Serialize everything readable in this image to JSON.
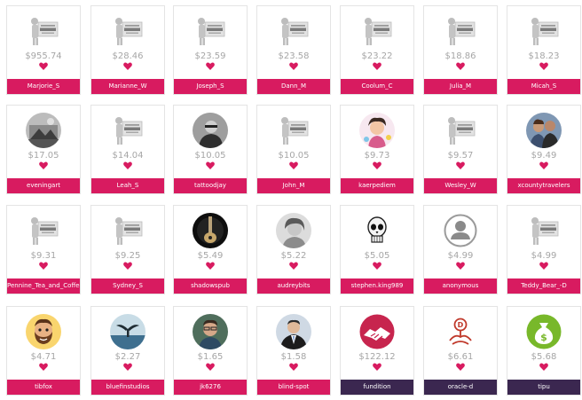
{
  "colors": {
    "name_band": "#d81b60",
    "name_band_org": "#3b2750",
    "heart": "#d81b60",
    "amount_text": "#a6a6a6"
  },
  "cards": [
    {
      "amount": "$955.74",
      "name": "Marjorie_S",
      "avatar": "no-image-placeholder"
    },
    {
      "amount": "$28.46",
      "name": "Marianne_W",
      "avatar": "no-image-placeholder"
    },
    {
      "amount": "$23.59",
      "name": "Joseph_S",
      "avatar": "no-image-placeholder"
    },
    {
      "amount": "$23.58",
      "name": "Dann_M",
      "avatar": "no-image-placeholder"
    },
    {
      "amount": "$23.22",
      "name": "Coolum_C",
      "avatar": "no-image-placeholder"
    },
    {
      "amount": "$18.86",
      "name": "Julia_M",
      "avatar": "no-image-placeholder"
    },
    {
      "amount": "$18.23",
      "name": "Micah_S",
      "avatar": "no-image-placeholder"
    },
    {
      "amount": "$17.05",
      "name": "eveningart",
      "avatar": "photo-bw-sketch"
    },
    {
      "amount": "$14.04",
      "name": "Leah_S",
      "avatar": "no-image-placeholder"
    },
    {
      "amount": "$10.05",
      "name": "tattoodjay",
      "avatar": "photo-man-gray"
    },
    {
      "amount": "$10.05",
      "name": "John_M",
      "avatar": "no-image-placeholder"
    },
    {
      "amount": "$9.73",
      "name": "kaerpediem",
      "avatar": "photo-cartoon-girl"
    },
    {
      "amount": "$9.57",
      "name": "Wesley_W",
      "avatar": "no-image-placeholder"
    },
    {
      "amount": "$9.49",
      "name": "xcountytravelers",
      "avatar": "photo-couple"
    },
    {
      "amount": "$9.31",
      "name": "Pennine_Tea_and_Coffee",
      "avatar": "no-image-placeholder"
    },
    {
      "amount": "$9.25",
      "name": "Sydney_S",
      "avatar": "no-image-placeholder"
    },
    {
      "amount": "$5.49",
      "name": "shadowspub",
      "avatar": "photo-dark-guitar"
    },
    {
      "amount": "$5.22",
      "name": "audreybits",
      "avatar": "photo-woman-gray"
    },
    {
      "amount": "$5.05",
      "name": "stephen.king989",
      "avatar": "skull-drawing"
    },
    {
      "amount": "$4.99",
      "name": "anonymous",
      "avatar": "anonymous-user-icon"
    },
    {
      "amount": "$4.99",
      "name": "Teddy_Bear_-D",
      "avatar": "no-image-placeholder"
    },
    {
      "amount": "$4.71",
      "name": "tibfox",
      "avatar": "cartoon-bearded-man"
    },
    {
      "amount": "$2.27",
      "name": "bluefinstudios",
      "avatar": "photo-whale-tail"
    },
    {
      "amount": "$1.65",
      "name": "jk6276",
      "avatar": "photo-man-glasses"
    },
    {
      "amount": "$1.58",
      "name": "blind-spot",
      "avatar": "photo-man-suit"
    },
    {
      "amount": "$122.12",
      "name": "fundition",
      "avatar": "handshake-logo",
      "org": true
    },
    {
      "amount": "$6.61",
      "name": "oracle-d",
      "avatar": "oracle-d-logo",
      "org": true
    },
    {
      "amount": "$5.68",
      "name": "tipu",
      "avatar": "money-bag-logo",
      "org": true
    }
  ]
}
